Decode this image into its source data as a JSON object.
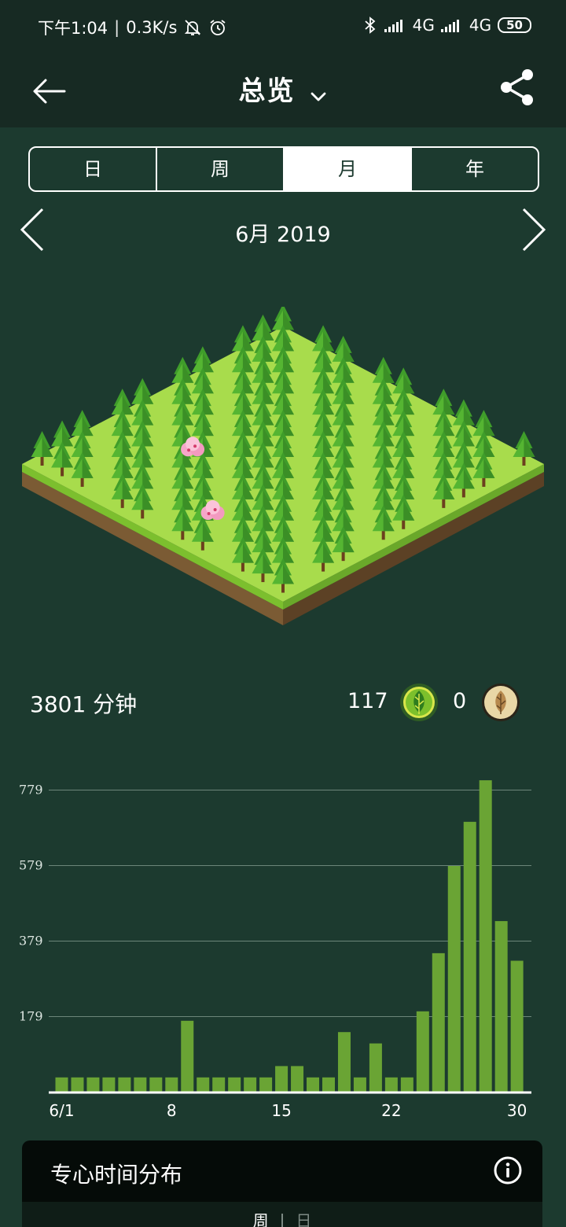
{
  "status_bar": {
    "time": "下午1:04",
    "speed": "0.3K/s",
    "net1": "4G",
    "net2": "4G",
    "battery": "50"
  },
  "header": {
    "title": "总览"
  },
  "tabs": [
    {
      "label": "日",
      "active": false
    },
    {
      "label": "周",
      "active": false
    },
    {
      "label": "月",
      "active": true
    },
    {
      "label": "年",
      "active": false
    }
  ],
  "period": {
    "label": "6月 2019"
  },
  "stats": {
    "total_time": "3801 分钟",
    "healthy_trees": "117",
    "dead_trees": "0"
  },
  "chart_data": {
    "type": "bar",
    "x": [
      1,
      2,
      3,
      4,
      5,
      6,
      7,
      8,
      9,
      10,
      11,
      12,
      13,
      14,
      15,
      16,
      17,
      18,
      19,
      20,
      21,
      22,
      23,
      24,
      25,
      26,
      27,
      28,
      29,
      30
    ],
    "values": [
      18,
      18,
      18,
      18,
      18,
      18,
      18,
      18,
      168,
      18,
      18,
      18,
      18,
      18,
      48,
      48,
      18,
      18,
      138,
      18,
      108,
      18,
      18,
      193,
      347,
      578,
      695,
      805,
      432,
      327
    ],
    "y_ticks": [
      179,
      379,
      579,
      779
    ],
    "x_tick_labels": [
      {
        "x": 1,
        "label": "6/1"
      },
      {
        "x": 8,
        "label": "8"
      },
      {
        "x": 15,
        "label": "15"
      },
      {
        "x": 22,
        "label": "22"
      },
      {
        "x": 30,
        "label": "30"
      }
    ],
    "bar_color": "#6aa434",
    "grid": true
  },
  "card": {
    "title": "专心时间分布",
    "sub_tabs": [
      "周",
      "日"
    ]
  },
  "colors": {
    "background": "#1c3a2f",
    "bar_background": "#172a23",
    "accent_green": "#6aa434"
  }
}
